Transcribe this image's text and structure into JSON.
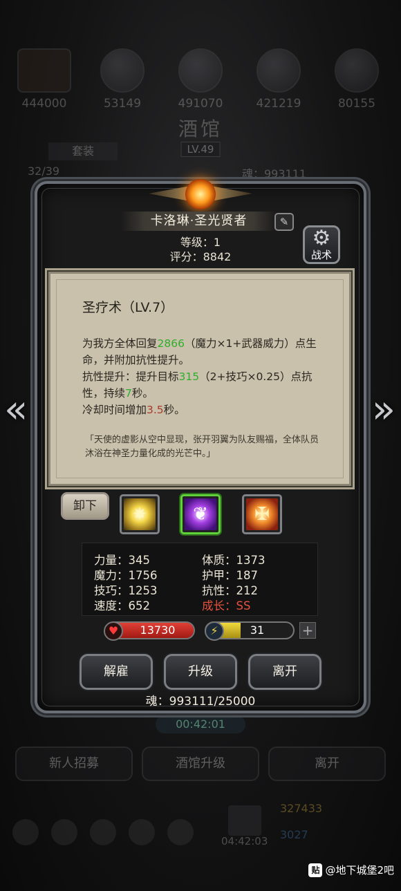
{
  "background": {
    "resource_counts": [
      "444000",
      "53149",
      "491070",
      "421219",
      "80155"
    ],
    "title": "酒馆",
    "tavern_level": "LV.49",
    "set_tab": "套装",
    "hero_count": "32/39",
    "soul_short": "魂：993111",
    "timer": "00:42:01",
    "bottom_buttons": [
      "新人招募",
      "酒馆升级",
      "离开"
    ],
    "gift_timer": "04:42:03",
    "gold": "327433",
    "gem": "3027"
  },
  "hero": {
    "name": "卡洛琳·圣光贤者",
    "level": "等级：1",
    "score": "评分：8842",
    "tactics_label": "战术"
  },
  "skill": {
    "title": "圣疗术（LV.7）",
    "desc": [
      {
        "t": "为我方全体回复",
        "c": ""
      },
      {
        "t": "2866",
        "c": "g"
      },
      {
        "t": "（魔力×1+武器威力）点生命，并附加抗性提升。",
        "c": ""
      },
      {
        "t": "抗性提升：提升目标",
        "c": ""
      },
      {
        "t": "315",
        "c": "g"
      },
      {
        "t": "（2+技巧×0.25）点抗性，持续",
        "c": ""
      },
      {
        "t": "7",
        "c": "g"
      },
      {
        "t": "秒。",
        "c": ""
      },
      {
        "t": "冷却时间增加",
        "c": ""
      },
      {
        "t": "3.5",
        "c": "r"
      },
      {
        "t": "秒。",
        "c": ""
      }
    ],
    "flavor": "「天使的虚影从空中显现，张开羽翼为队友赐福，全体队员沐浴在神圣力量化成的光芒中。」"
  },
  "unload_label": "卸下",
  "skill_slots": [
    {
      "name": "holy-burst-skill-icon",
      "glyph": "✷"
    },
    {
      "name": "purple-rune-skill-icon",
      "glyph": "❦"
    },
    {
      "name": "angel-blessing-skill-icon",
      "glyph": "✠"
    }
  ],
  "stats": {
    "strength": "力量：345",
    "magic": "魔力：1756",
    "skill": "技巧：1253",
    "speed": "速度：652",
    "physique": "体质：1373",
    "armor": "护甲：187",
    "resist": "抗性：212",
    "growth": "成长：SS"
  },
  "hp": {
    "value": "13730",
    "fill": 1.0
  },
  "energy": {
    "value": "31",
    "fill": 0.4
  },
  "actions": {
    "dismiss": "解雇",
    "upgrade": "升级",
    "leave": "离开"
  },
  "soul": "魂：993111/25000",
  "watermark": "@地下城堡2吧",
  "watermark_badge": "贴"
}
